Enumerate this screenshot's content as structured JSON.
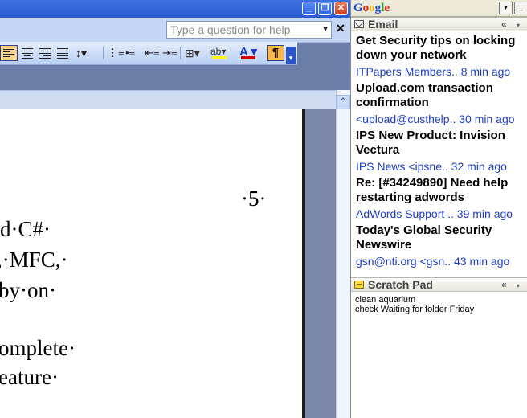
{
  "word": {
    "help_placeholder": "Type a question for help",
    "window_buttons": {
      "minimize": "_",
      "restore": "❐",
      "close": "✕"
    },
    "doc_close": "✕",
    "toolbar": {
      "line_spacing_glyph": "↕▾",
      "numbering_glyph": "⋮≡",
      "bullets_glyph": "•≡",
      "dec_indent_glyph": "⇤≡",
      "inc_indent_glyph": "⇥≡",
      "borders_glyph": "⊞▾",
      "highlight_glyph": "ab▾",
      "font_color_glyph": "A ▾",
      "pilcrow_glyph": "¶",
      "chevron_glyph": "▾",
      "highlight_color": "#ffff00",
      "font_color": "#d40000"
    },
    "scroll_up_glyph": "⌃",
    "document_lines": [
      "·5·",
      "d·C#·",
      ",·MFC,·",
      "by·on·",
      "",
      "omplete·",
      "eature·"
    ]
  },
  "google": {
    "logo": [
      "G",
      "o",
      "o",
      "g",
      "l",
      "e"
    ],
    "logo_colors": [
      "#1b4fd8",
      "#d5281c",
      "#e8b100",
      "#1b4fd8",
      "#1f9d22",
      "#d5281c"
    ],
    "menu_glyph": "▾",
    "minimize_glyph": "_",
    "email": {
      "title": "Email",
      "collapse_glyph": "«",
      "menu_glyph": "▾",
      "items": [
        {
          "subject": "Get Security tips on locking down your network",
          "meta": "ITPapers Members.. 8 min ago"
        },
        {
          "subject": "Upload.com transaction confirmation",
          "meta": "<upload@custhelp.. 30 min ago"
        },
        {
          "subject": "IPS New Product: Invision Vectura",
          "meta": "IPS News <ipsne..   32 min ago"
        },
        {
          "subject": "Re: [#34249890] Need help restarting adwords",
          "meta": "AdWords Support .. 39 min ago"
        },
        {
          "subject": "Today's Global Security Newswire",
          "meta": "gsn@nti.org <gsn.. 43 min ago"
        }
      ]
    },
    "scratch_pad": {
      "title": "Scratch Pad",
      "collapse_glyph": "«",
      "menu_glyph": "▾",
      "lines": [
        "clean aquarium",
        "check Waiting for folder Friday"
      ]
    }
  }
}
